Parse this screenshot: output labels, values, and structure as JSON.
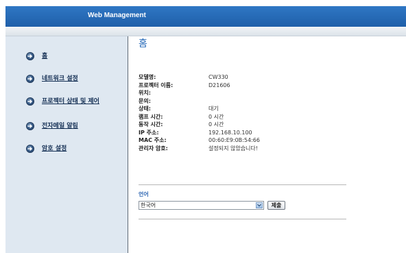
{
  "header": {
    "title": "Web Management"
  },
  "sidebar": {
    "items": [
      {
        "label": "홈",
        "icon": "arrow-right-icon"
      },
      {
        "label": "네트워크 설정",
        "icon": "arrow-right-icon"
      },
      {
        "label": "프로젝터 상태 및 제어",
        "icon": "arrow-right-icon"
      },
      {
        "label": "전자메일 알림",
        "icon": "arrow-right-icon"
      },
      {
        "label": "암호 설정",
        "icon": "arrow-right-icon"
      }
    ]
  },
  "main": {
    "title": "홈",
    "info": [
      {
        "label": "모델명:",
        "value": "CW330"
      },
      {
        "label": "프로젝터 이름:",
        "value": "D21606"
      },
      {
        "label": "위치:",
        "value": ""
      },
      {
        "label": "문의:",
        "value": ""
      },
      {
        "label": "상태:",
        "value": "대기"
      },
      {
        "label": "램프 시간:",
        "value": "0 시간"
      },
      {
        "label": "동작 시간:",
        "value": "0 시간"
      },
      {
        "label": "IP 주소:",
        "value": "192.168.10.100"
      },
      {
        "label": "MAC 주소:",
        "value": "00:60:E9:0B:54:66"
      },
      {
        "label": "관리자 암호:",
        "value": "설정되지 않았습니다!"
      }
    ],
    "language": {
      "title": "언어",
      "selected": "한국어",
      "submit_label": "제출"
    }
  },
  "colors": {
    "header_blue": "#2f77c4",
    "sidebar_bg": "#dfe8f1",
    "title_blue": "#2267b7",
    "nav_icon": "#365a86"
  }
}
